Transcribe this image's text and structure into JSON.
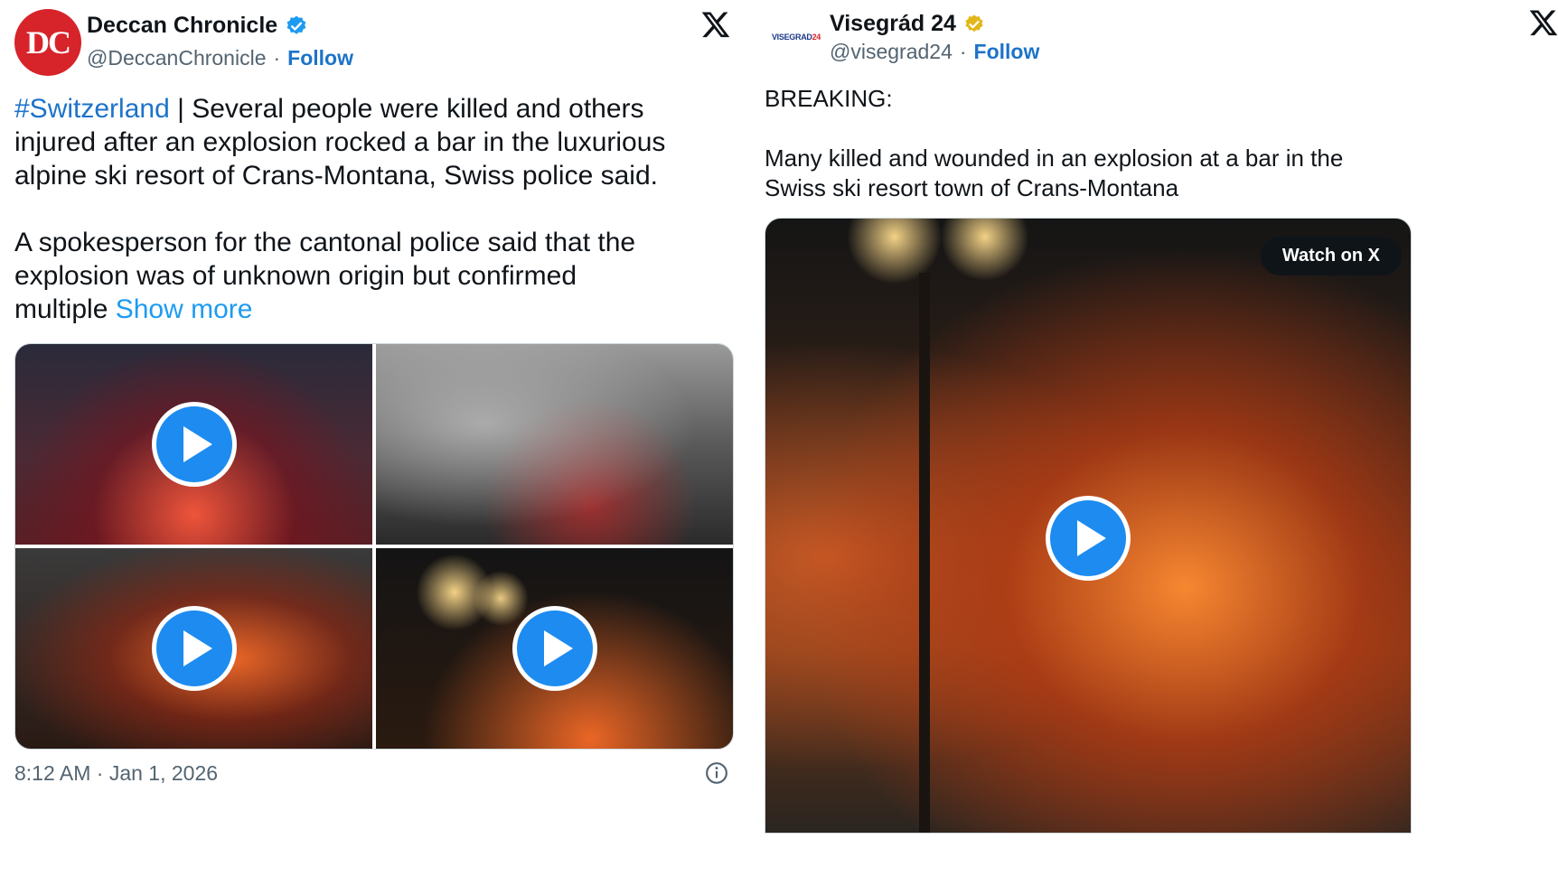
{
  "left_tweet": {
    "avatar_text": "DC",
    "display_name": "Deccan Chronicle",
    "handle": "@DeccanChronicle",
    "separator": "·",
    "follow_label": "Follow",
    "hashtag": "#Switzerland",
    "text_line1_rest": " | Several people were killed and others",
    "text_line2": "injured after an explosion rocked a bar in the luxurious",
    "text_line3": "alpine ski resort of Crans-Montana, Swiss police said.",
    "text_para2_line1": "A spokesperson for the cantonal police said that the",
    "text_para2_line2": "explosion was of unknown origin but confirmed",
    "text_para2_line3": "multiple ",
    "show_more_label": "Show more",
    "timestamp": "8:12 AM · Jan 1, 2026",
    "media_count": 4
  },
  "right_tweet": {
    "avatar_text_blue": "VISEGRAD",
    "avatar_text_red": "24",
    "display_name": "Visegrád 24",
    "handle": "@visegrad24",
    "separator": "·",
    "follow_label": "Follow",
    "text_line1": "BREAKING:",
    "text_line2": "Many killed and wounded in an explosion at a bar in the",
    "text_line3": "Swiss ski resort town of Crans-Montana",
    "watch_label": "Watch on X"
  },
  "icons": {
    "verified_blue": "verified-badge-icon",
    "verified_gold": "verified-org-badge-icon",
    "x_logo": "x-logo-icon",
    "play": "play-icon",
    "info": "info-icon"
  },
  "colors": {
    "link_blue": "#1d73c9",
    "show_more_blue": "#1d9bf0",
    "play_blue": "#1d8bf0",
    "verified_blue": "#1d9bf0",
    "verified_gold": "#e2b719",
    "brand_red": "#d7232a"
  }
}
